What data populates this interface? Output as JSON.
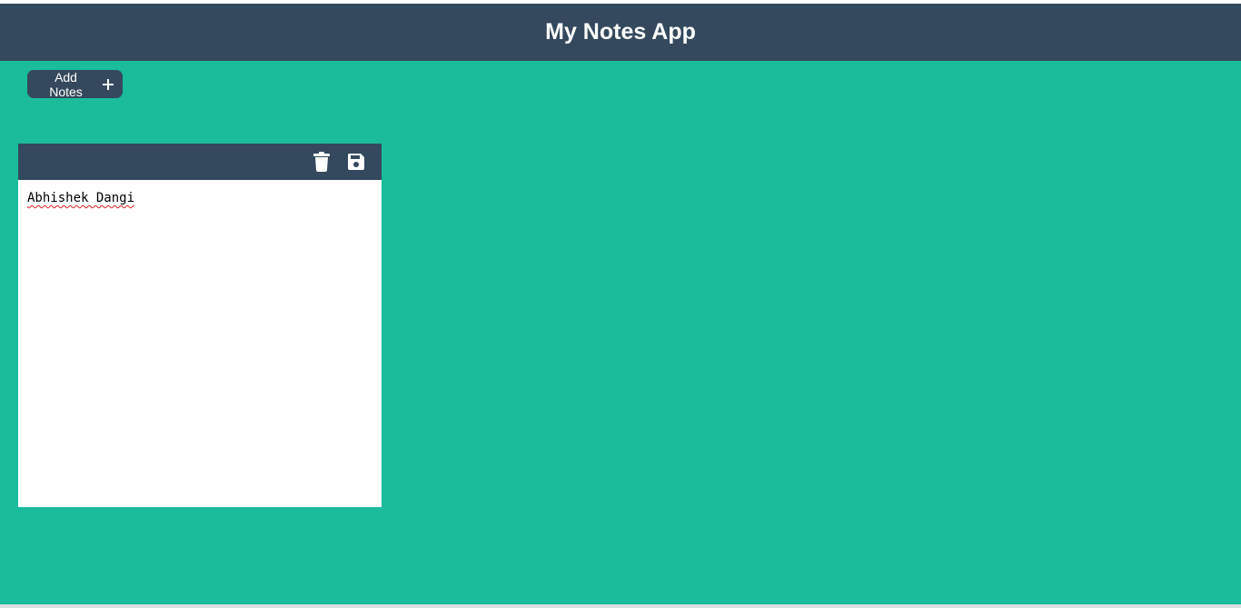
{
  "header": {
    "title": "My Notes App"
  },
  "toolbar": {
    "add_label": "Add Notes",
    "add_icon": "plus-icon"
  },
  "notes": [
    {
      "text": "Abhishek Dangi",
      "actions": [
        {
          "icon": "trash-icon"
        },
        {
          "icon": "save-icon"
        }
      ]
    }
  ],
  "colors": {
    "background": "#1abc9c",
    "header": "#34495e",
    "note_body": "#ffffff",
    "spellcheck_underline": "#e02020"
  }
}
